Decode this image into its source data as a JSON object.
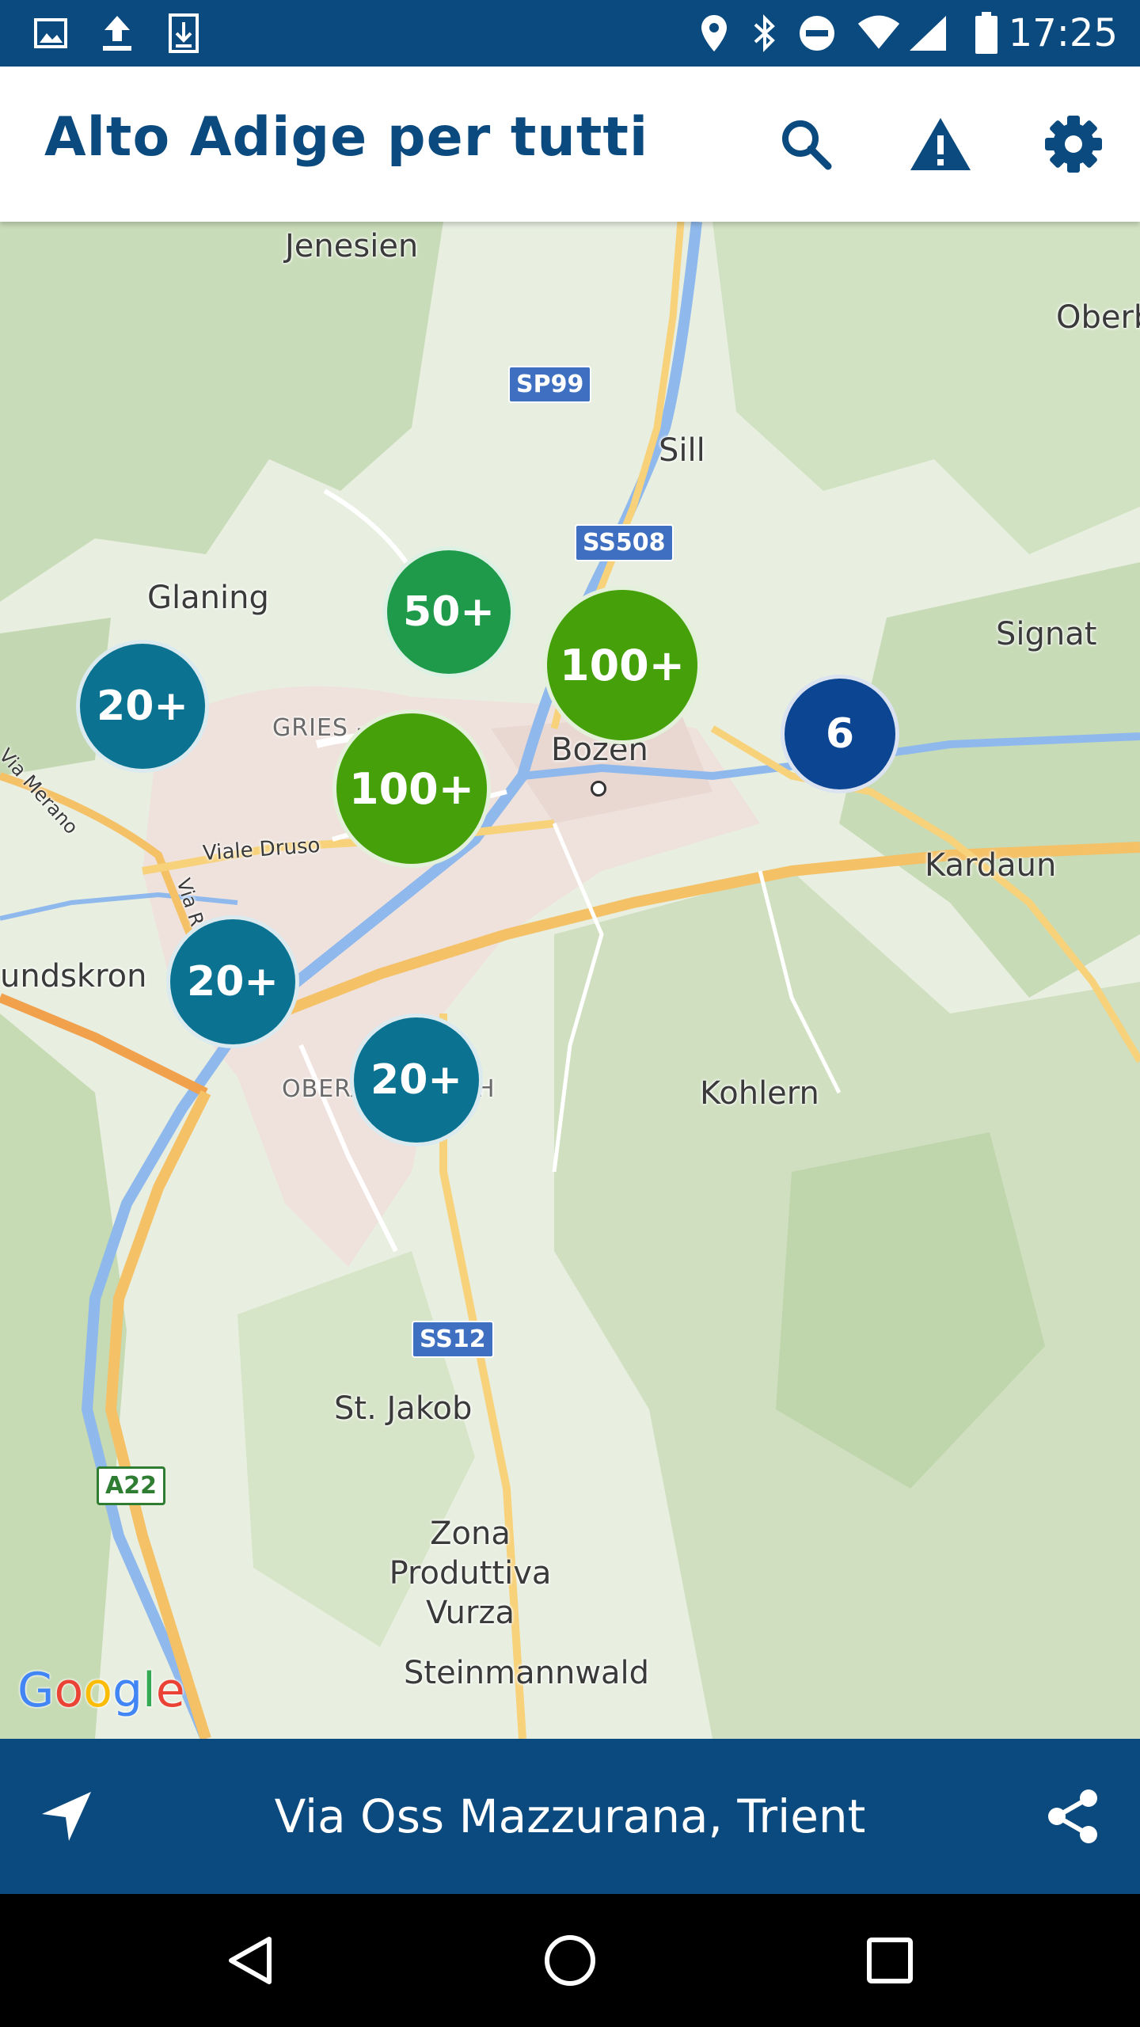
{
  "status_bar": {
    "time": "17:25",
    "icons": [
      "image-icon",
      "upload-icon",
      "download-icon",
      "location-icon",
      "bluetooth-icon",
      "do-not-disturb-icon",
      "wifi-icon",
      "signal-icon",
      "battery-icon"
    ]
  },
  "app_bar": {
    "title": "Alto Adige per tutti",
    "actions": [
      "search-icon",
      "warning-icon",
      "settings-icon"
    ]
  },
  "map": {
    "places": {
      "jenesien": "Jenesien",
      "oberb": "Oberb",
      "sill": "Sill",
      "glaning": "Glaning",
      "signat": "Signat",
      "gries": "GRIES - Q",
      "bozen": "Bozen",
      "via_merano": "Via Merano",
      "viale_druso": "Viale Druso",
      "via_r": "Via R",
      "kardaun": "Kardaun",
      "undskron": "undskron",
      "oberau_left": "OBERA",
      "oberau_right": "H",
      "kohlern": "Kohlern",
      "st_jakob": "St. Jakob",
      "zona": "Zona\nProduttiva\nVurza",
      "steinmannwald": "Steinmannwald"
    },
    "roads": {
      "sp99": "SP99",
      "ss508": "SS508",
      "ss12": "SS12",
      "a22": "A22"
    },
    "clusters": {
      "c1": "50+",
      "c2": "100+",
      "c3": "20+",
      "c4": "100+",
      "c5": "6",
      "c6": "20+",
      "c7": "20+"
    },
    "colors": {
      "green_dark": "#1e9a4a",
      "green": "#45a00a",
      "teal": "#0b7391",
      "navy": "#0c4592"
    },
    "attribution": "Google"
  },
  "bottom_bar": {
    "address": "Via Oss Mazzurana, Trient"
  },
  "nav_bar": {
    "buttons": [
      "back-icon",
      "home-icon",
      "recents-icon"
    ]
  }
}
